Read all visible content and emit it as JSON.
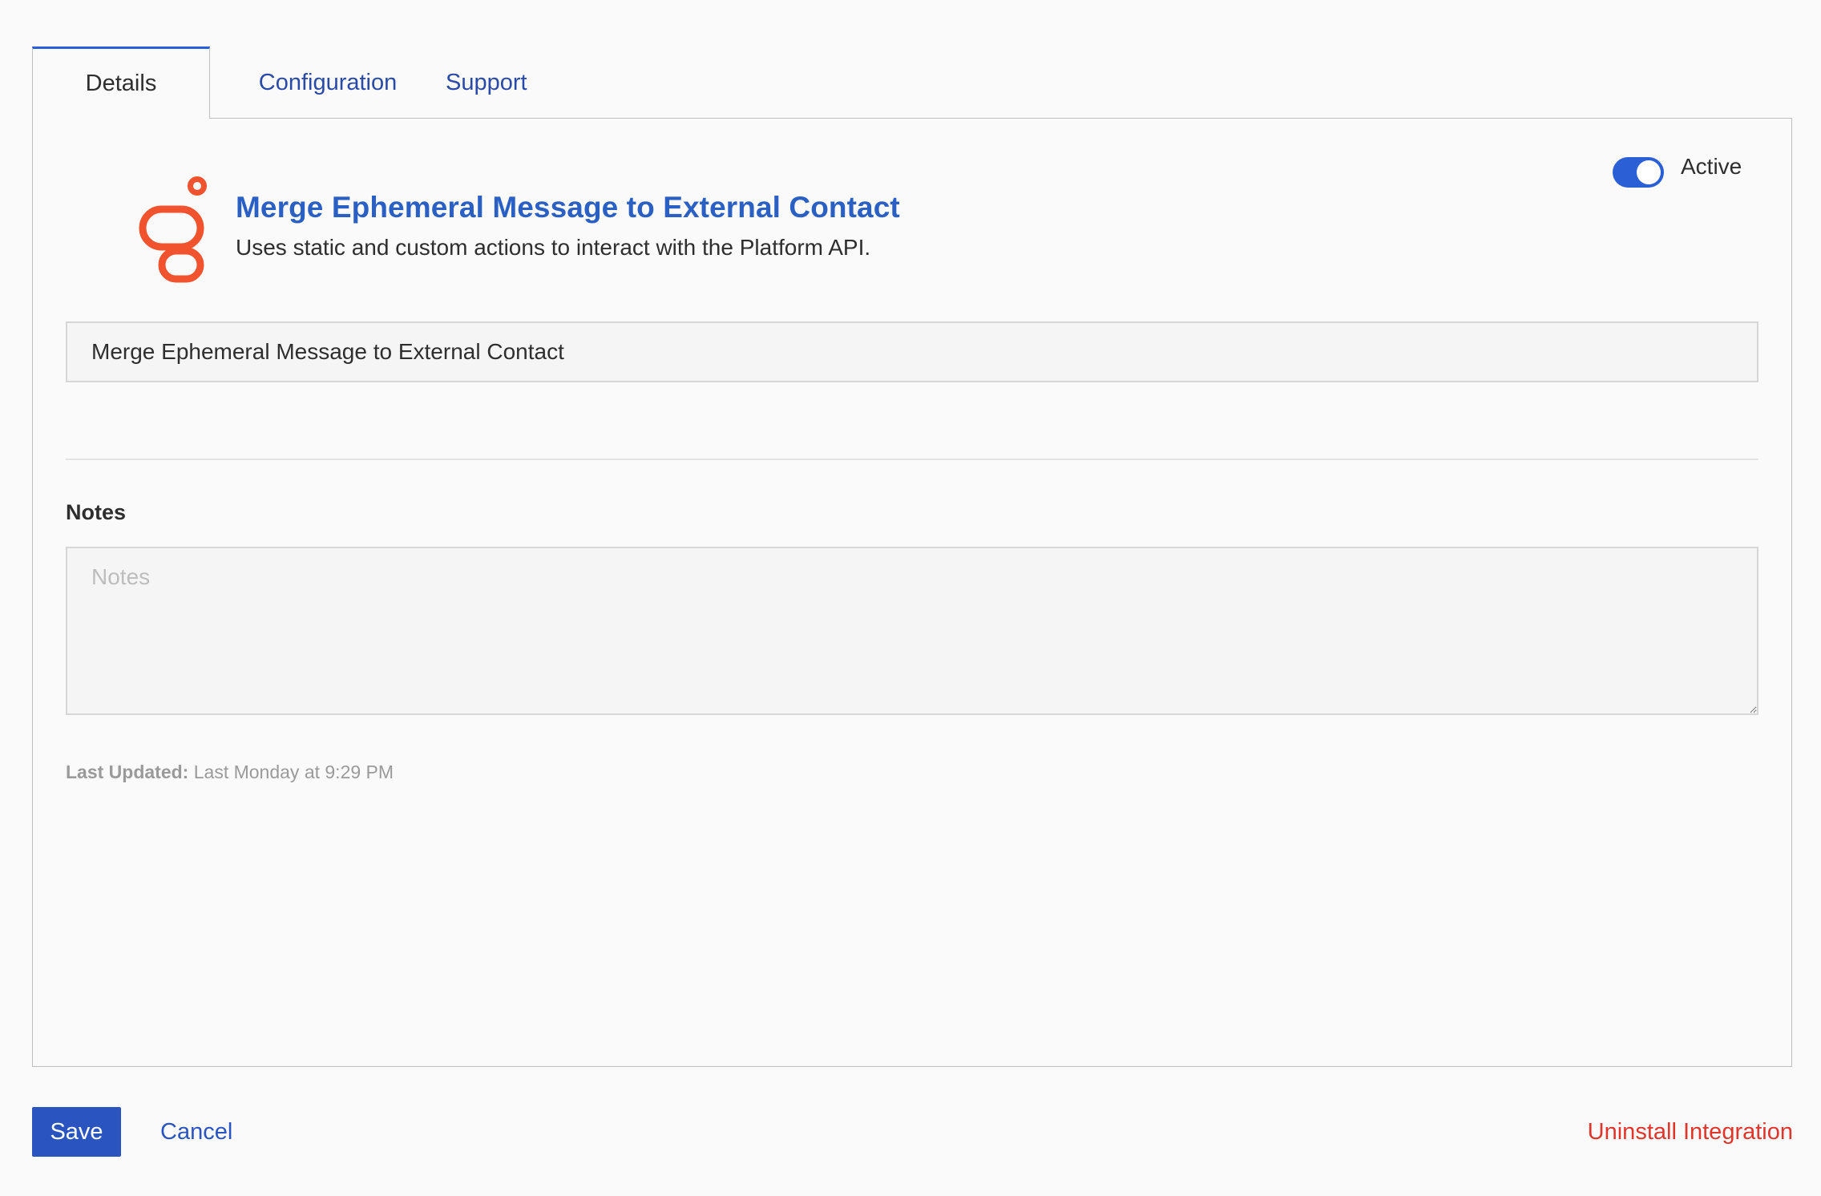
{
  "tabs": {
    "details": "Details",
    "configuration": "Configuration",
    "support": "Support",
    "active_tab": "Details"
  },
  "integration": {
    "logo_icon": "genesys-logo-icon",
    "logo_color": "#f0532e",
    "title": "Merge Ephemeral Message to External Contact",
    "description": "Uses static and custom actions to interact with the Platform API.",
    "active": true,
    "active_label": "Active"
  },
  "form": {
    "name_value": "Merge Ephemeral Message to External Contact",
    "notes_label": "Notes",
    "notes_placeholder": "Notes",
    "notes_value": "",
    "last_updated_label": "Last Updated:",
    "last_updated_value": "Last Monday at 9:29 PM"
  },
  "footer": {
    "save_label": "Save",
    "cancel_label": "Cancel",
    "uninstall_label": "Uninstall Integration"
  },
  "colors": {
    "accent": "#2a5fd6",
    "title": "#2a5fc4",
    "danger": "#e0352b"
  }
}
